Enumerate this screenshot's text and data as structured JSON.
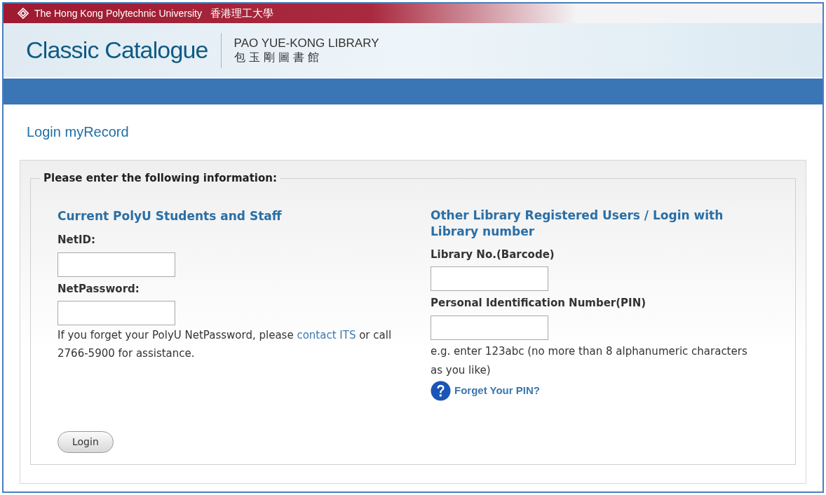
{
  "top_bar": {
    "university": "The Hong Kong Polytechnic University",
    "university_zh": "香港理工大學"
  },
  "header": {
    "logo": "Classic Catalogue",
    "library": "PAO YUE-KONG LIBRARY",
    "library_zh": "包 玉 剛 圖 書 館"
  },
  "page_title": "Login myRecord",
  "form": {
    "legend": "Please enter the following information:",
    "left": {
      "heading": "Current PolyU Students and Staff",
      "fields": [
        {
          "label": "NetID:"
        },
        {
          "label": "NetPassword:"
        }
      ],
      "help": {
        "before": "If you forget your PolyU NetPassword, please ",
        "link": "contact ITS",
        "after": " or call 2766-5900 for assistance."
      },
      "button": "Login"
    },
    "right": {
      "heading": "Other Library Registered Users / Login with Library number",
      "fields": [
        {
          "label": "Library No.(Barcode)"
        },
        {
          "label": "Personal Identification Number(PIN)"
        }
      ],
      "hint": "e.g. enter 123abc (no more than 8 alphanumeric characters as you like)",
      "help_link": "Forget Your PIN?"
    }
  }
}
